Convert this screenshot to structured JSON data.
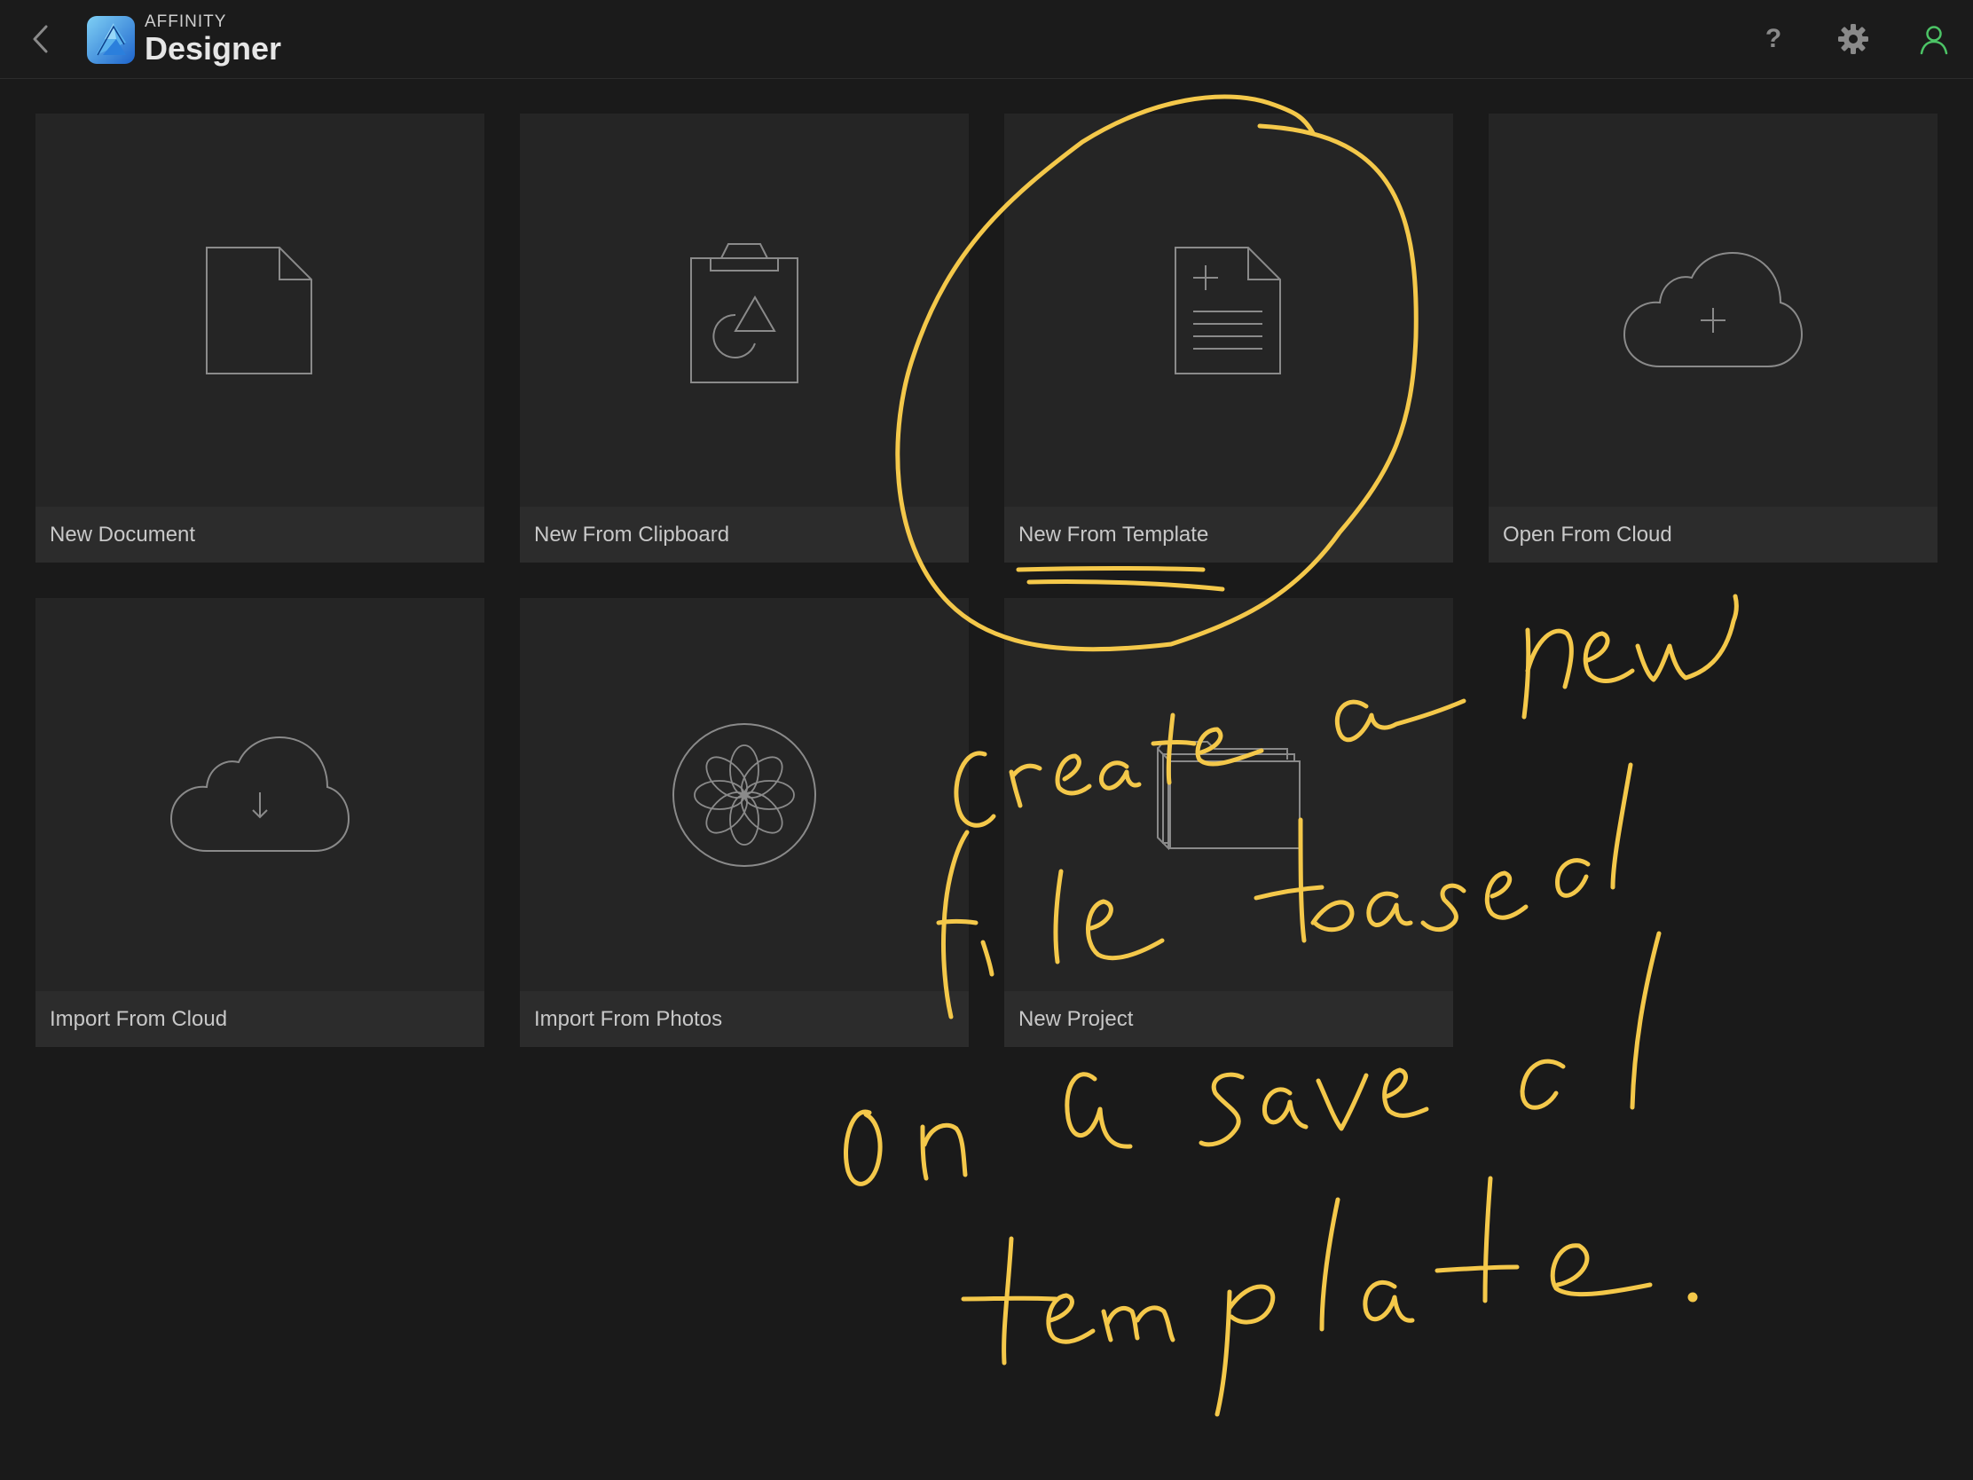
{
  "header": {
    "brand_small": "AFFINITY",
    "brand_main": "Designer",
    "help_label": "?"
  },
  "tiles": [
    {
      "label": "New Document",
      "icon": "document-icon"
    },
    {
      "label": "New From Clipboard",
      "icon": "clipboard-icon"
    },
    {
      "label": "New From Template",
      "icon": "template-icon"
    },
    {
      "label": "Open From Cloud",
      "icon": "cloud-plus-icon"
    },
    {
      "label": "Import From Cloud",
      "icon": "cloud-download-icon"
    },
    {
      "label": "Import From Photos",
      "icon": "photos-icon"
    },
    {
      "label": "New Project",
      "icon": "project-folder-icon"
    }
  ],
  "colors": {
    "background": "#1a1a1a",
    "tile": "#252525",
    "tile_label_bar": "#2c2c2c",
    "icon_stroke": "#8a8a8a",
    "user_icon": "#4cc466",
    "annotation": "#f4c84a",
    "logo_gradient_top": "#6fc4f2",
    "logo_gradient_bottom": "#1f6fd2"
  },
  "annotation_text": "create a new file based on a saved template."
}
